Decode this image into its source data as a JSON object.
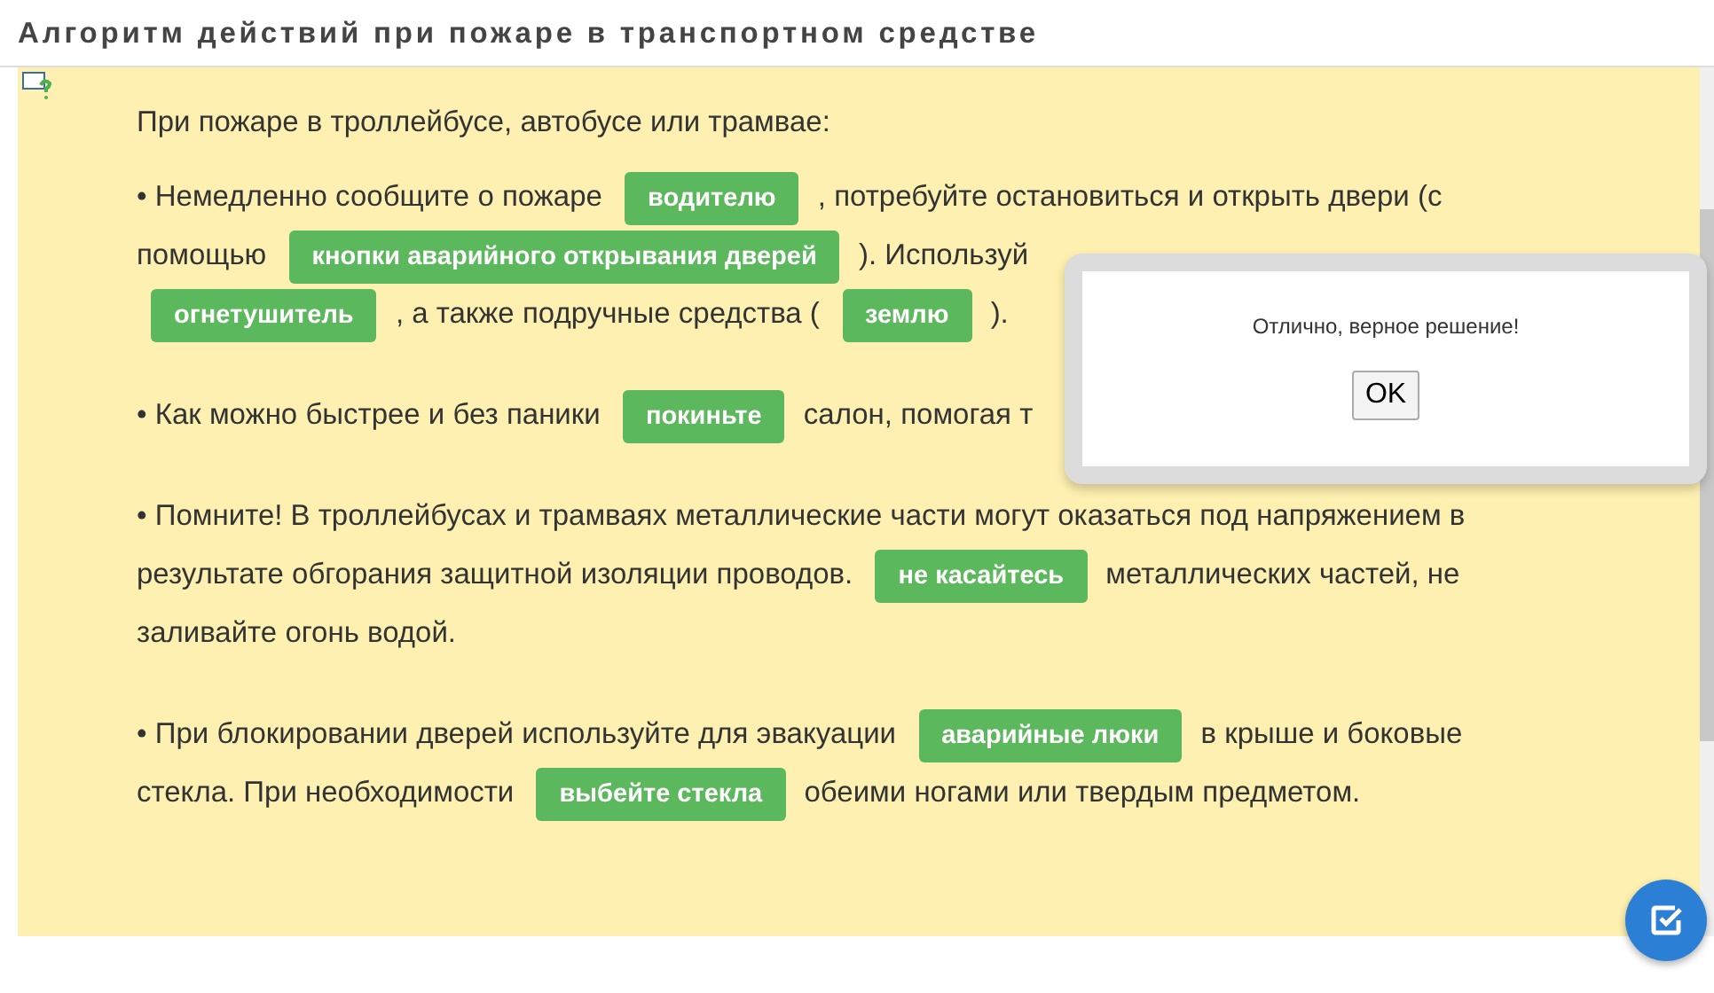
{
  "title": "Алгоритм действий при пожаре в транспортном средстве",
  "intro": "При пожаре в троллейбусе, автобусе или трамвае:",
  "paragraphs": [
    [
      {
        "kind": "text",
        "text": "• Немедленно сообщите о пожаре"
      },
      {
        "kind": "chip",
        "text": "водителю"
      },
      {
        "kind": "text",
        "text": ", потребуйте остановиться и открыть двери (с"
      },
      {
        "kind": "break"
      },
      {
        "kind": "text",
        "text": "помощью"
      },
      {
        "kind": "chip",
        "text": "кнопки аварийного открывания дверей"
      },
      {
        "kind": "text",
        "text": "). Используй"
      },
      {
        "kind": "break"
      },
      {
        "kind": "chip",
        "text": "огнетушитель"
      },
      {
        "kind": "text",
        "text": ", а также подручные средства ("
      },
      {
        "kind": "chip",
        "text": "землю"
      },
      {
        "kind": "text",
        "text": ")."
      }
    ],
    [
      {
        "kind": "text",
        "text": "• Как можно быстрее и без паники"
      },
      {
        "kind": "chip",
        "text": "покиньте"
      },
      {
        "kind": "text",
        "text": "салон, помогая т"
      }
    ],
    [
      {
        "kind": "text",
        "text": "• Помните! В троллейбусах и трамваях металлические части могут оказаться под напряжением в"
      },
      {
        "kind": "break"
      },
      {
        "kind": "text",
        "text": "результате обгорания защитной изоляции проводов."
      },
      {
        "kind": "chip",
        "text": "не касайтесь"
      },
      {
        "kind": "text",
        "text": "металлических частей, не"
      },
      {
        "kind": "break"
      },
      {
        "kind": "text",
        "text": "заливайте огонь водой."
      }
    ],
    [
      {
        "kind": "text",
        "text": "• При блокировании дверей используйте для эвакуации"
      },
      {
        "kind": "chip",
        "text": "аварийные люки"
      },
      {
        "kind": "text",
        "text": "в крыше и боковые"
      },
      {
        "kind": "break"
      },
      {
        "kind": "text",
        "text": "стекла. При необходимости"
      },
      {
        "kind": "chip",
        "text": "выбейте стекла"
      },
      {
        "kind": "text",
        "text": "обеими ногами или твердым предметом."
      }
    ]
  ],
  "dialog": {
    "message": "Отлично, верное решение!",
    "button": "OK"
  }
}
